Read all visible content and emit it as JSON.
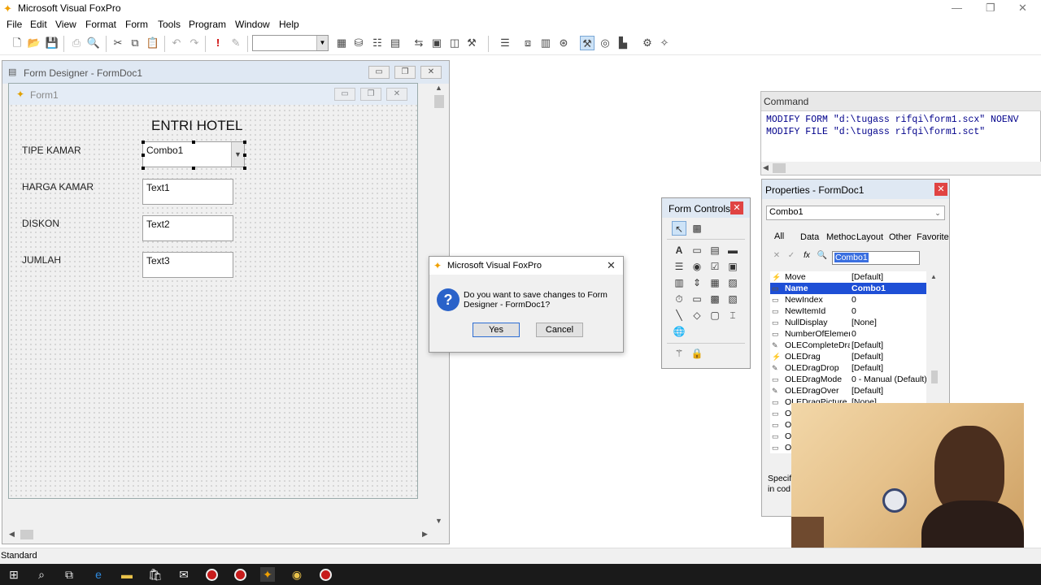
{
  "app": {
    "title": "Microsoft Visual FoxPro"
  },
  "menubar": [
    "File",
    "Edit",
    "View",
    "Format",
    "Form",
    "Tools",
    "Program",
    "Window",
    "Help"
  ],
  "form_designer": {
    "title": "Form Designer - FormDoc1",
    "form_title": "Form1",
    "heading": "ENTRI HOTEL",
    "labels": [
      "TIPE KAMAR",
      "HARGA KAMAR",
      "DISKON",
      "JUMLAH"
    ],
    "controls": [
      "Combo1",
      "Text1",
      "Text2",
      "Text3"
    ]
  },
  "command": {
    "title": "Command",
    "lines": [
      "MODIFY FORM \"d:\\tugass rifqi\\form1.scx\" NOENV",
      "MODIFY FILE \"d:\\tugass rifqi\\form1.sct\""
    ]
  },
  "form_controls": {
    "title": "Form Controls"
  },
  "properties": {
    "title": "Properties - FormDoc1",
    "object": "Combo1",
    "tabs": [
      "All",
      "Data",
      "Methoc",
      "Layout",
      "Other",
      "Favorite"
    ],
    "edit_value": "Combo1",
    "rows": [
      {
        "name": "Move",
        "value": "[Default]",
        "icon": "event"
      },
      {
        "name": "Name",
        "value": "Combo1",
        "icon": "prop",
        "selected": true
      },
      {
        "name": "NewIndex",
        "value": "0",
        "icon": "prop"
      },
      {
        "name": "NewItemId",
        "value": "0",
        "icon": "prop"
      },
      {
        "name": "NullDisplay",
        "value": "[None]",
        "icon": "prop"
      },
      {
        "name": "NumberOfElemen",
        "value": "0",
        "icon": "prop"
      },
      {
        "name": "OLECompleteDra",
        "value": "[Default]",
        "icon": "method"
      },
      {
        "name": "OLEDrag",
        "value": "[Default]",
        "icon": "event"
      },
      {
        "name": "OLEDragDrop",
        "value": "[Default]",
        "icon": "method"
      },
      {
        "name": "OLEDragMode",
        "value": "0 - Manual (Default)",
        "icon": "prop"
      },
      {
        "name": "OLEDragOver",
        "value": "[Default]",
        "icon": "method"
      },
      {
        "name": "OLEDragPicture",
        "value": "[None]",
        "icon": "prop"
      },
      {
        "name": "O",
        "value": "",
        "icon": "prop"
      },
      {
        "name": "O",
        "value": "",
        "icon": "prop"
      },
      {
        "name": "O",
        "value": "",
        "icon": "prop"
      },
      {
        "name": "O",
        "value": "",
        "icon": "prop"
      }
    ],
    "desc_line1": "Specif",
    "desc_line2": "in cod"
  },
  "dialog": {
    "title": "Microsoft Visual FoxPro",
    "message_line1": "Do you want to save changes to Form",
    "message_line2": "Designer - FormDoc1?",
    "yes": "Yes",
    "cancel": "Cancel"
  },
  "status": {
    "text": "Standard"
  }
}
